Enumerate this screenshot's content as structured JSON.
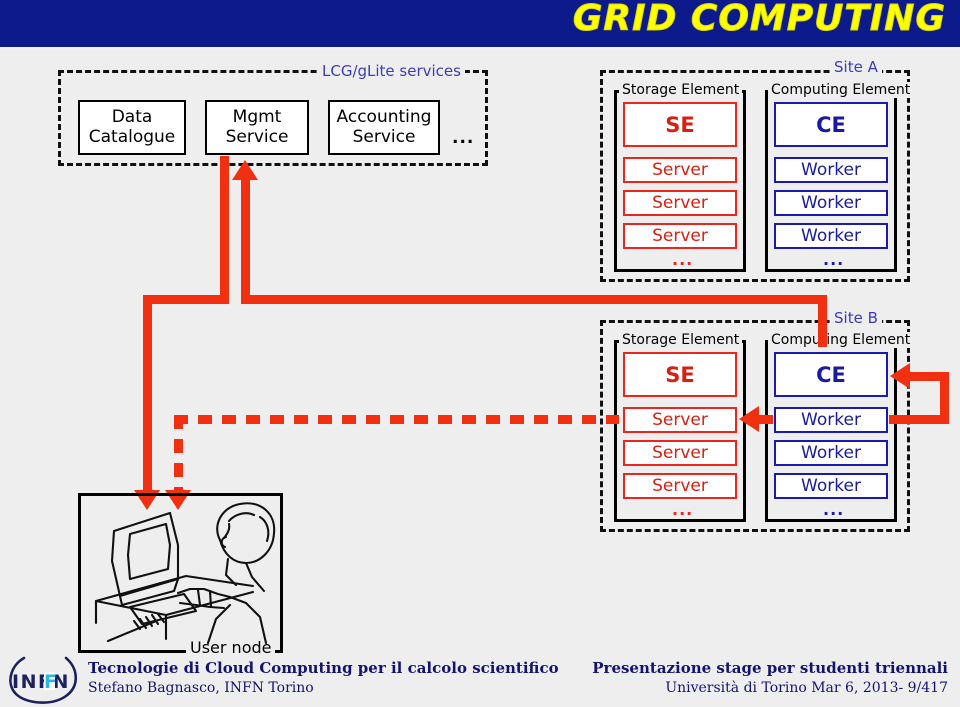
{
  "banner": {
    "title": "GRID COMPUTING",
    "bg_color": "#0d1a8c",
    "text_color": "#ffff00"
  },
  "services_panel": {
    "label": "LCG/gLite services",
    "boxes": [
      {
        "line1": "Data",
        "line2": "Catalogue"
      },
      {
        "line1": "Mgmt",
        "line2": "Service"
      },
      {
        "line1": "Accounting",
        "line2": "Service"
      }
    ],
    "ellipsis": "..."
  },
  "sites": [
    {
      "label": "Site A",
      "storage": {
        "label": "Storage Element",
        "head": "SE",
        "nodes": [
          "Server",
          "Server",
          "Server"
        ],
        "ellipsis": "...",
        "color": "#e8261c"
      },
      "computing": {
        "label": "Computing Element",
        "head": "CE",
        "nodes": [
          "Worker",
          "Worker",
          "Worker"
        ],
        "ellipsis": "...",
        "color": "#1a1ab0"
      }
    },
    {
      "label": "Site B",
      "storage": {
        "label": "Storage Element",
        "head": "SE",
        "nodes": [
          "Server",
          "Server",
          "Server"
        ],
        "ellipsis": "...",
        "color": "#e8261c"
      },
      "computing": {
        "label": "Computing Element",
        "head": "CE",
        "nodes": [
          "Worker",
          "Worker",
          "Worker"
        ],
        "ellipsis": "...",
        "color": "#1a1ab0"
      }
    }
  ],
  "user_node": {
    "label": "User node"
  },
  "connectors": {
    "color": "#f03010"
  },
  "footer": {
    "logo_text": "INFN",
    "left_title": "Tecnologie di Cloud Computing per il calcolo scientifico",
    "left_sub": "Stefano Bagnasco, INFN Torino",
    "right_title": "Presentazione stage per studenti triennali",
    "right_sub": "Università di Torino Mar 6, 2013- 9/417",
    "text_color": "#141470"
  }
}
